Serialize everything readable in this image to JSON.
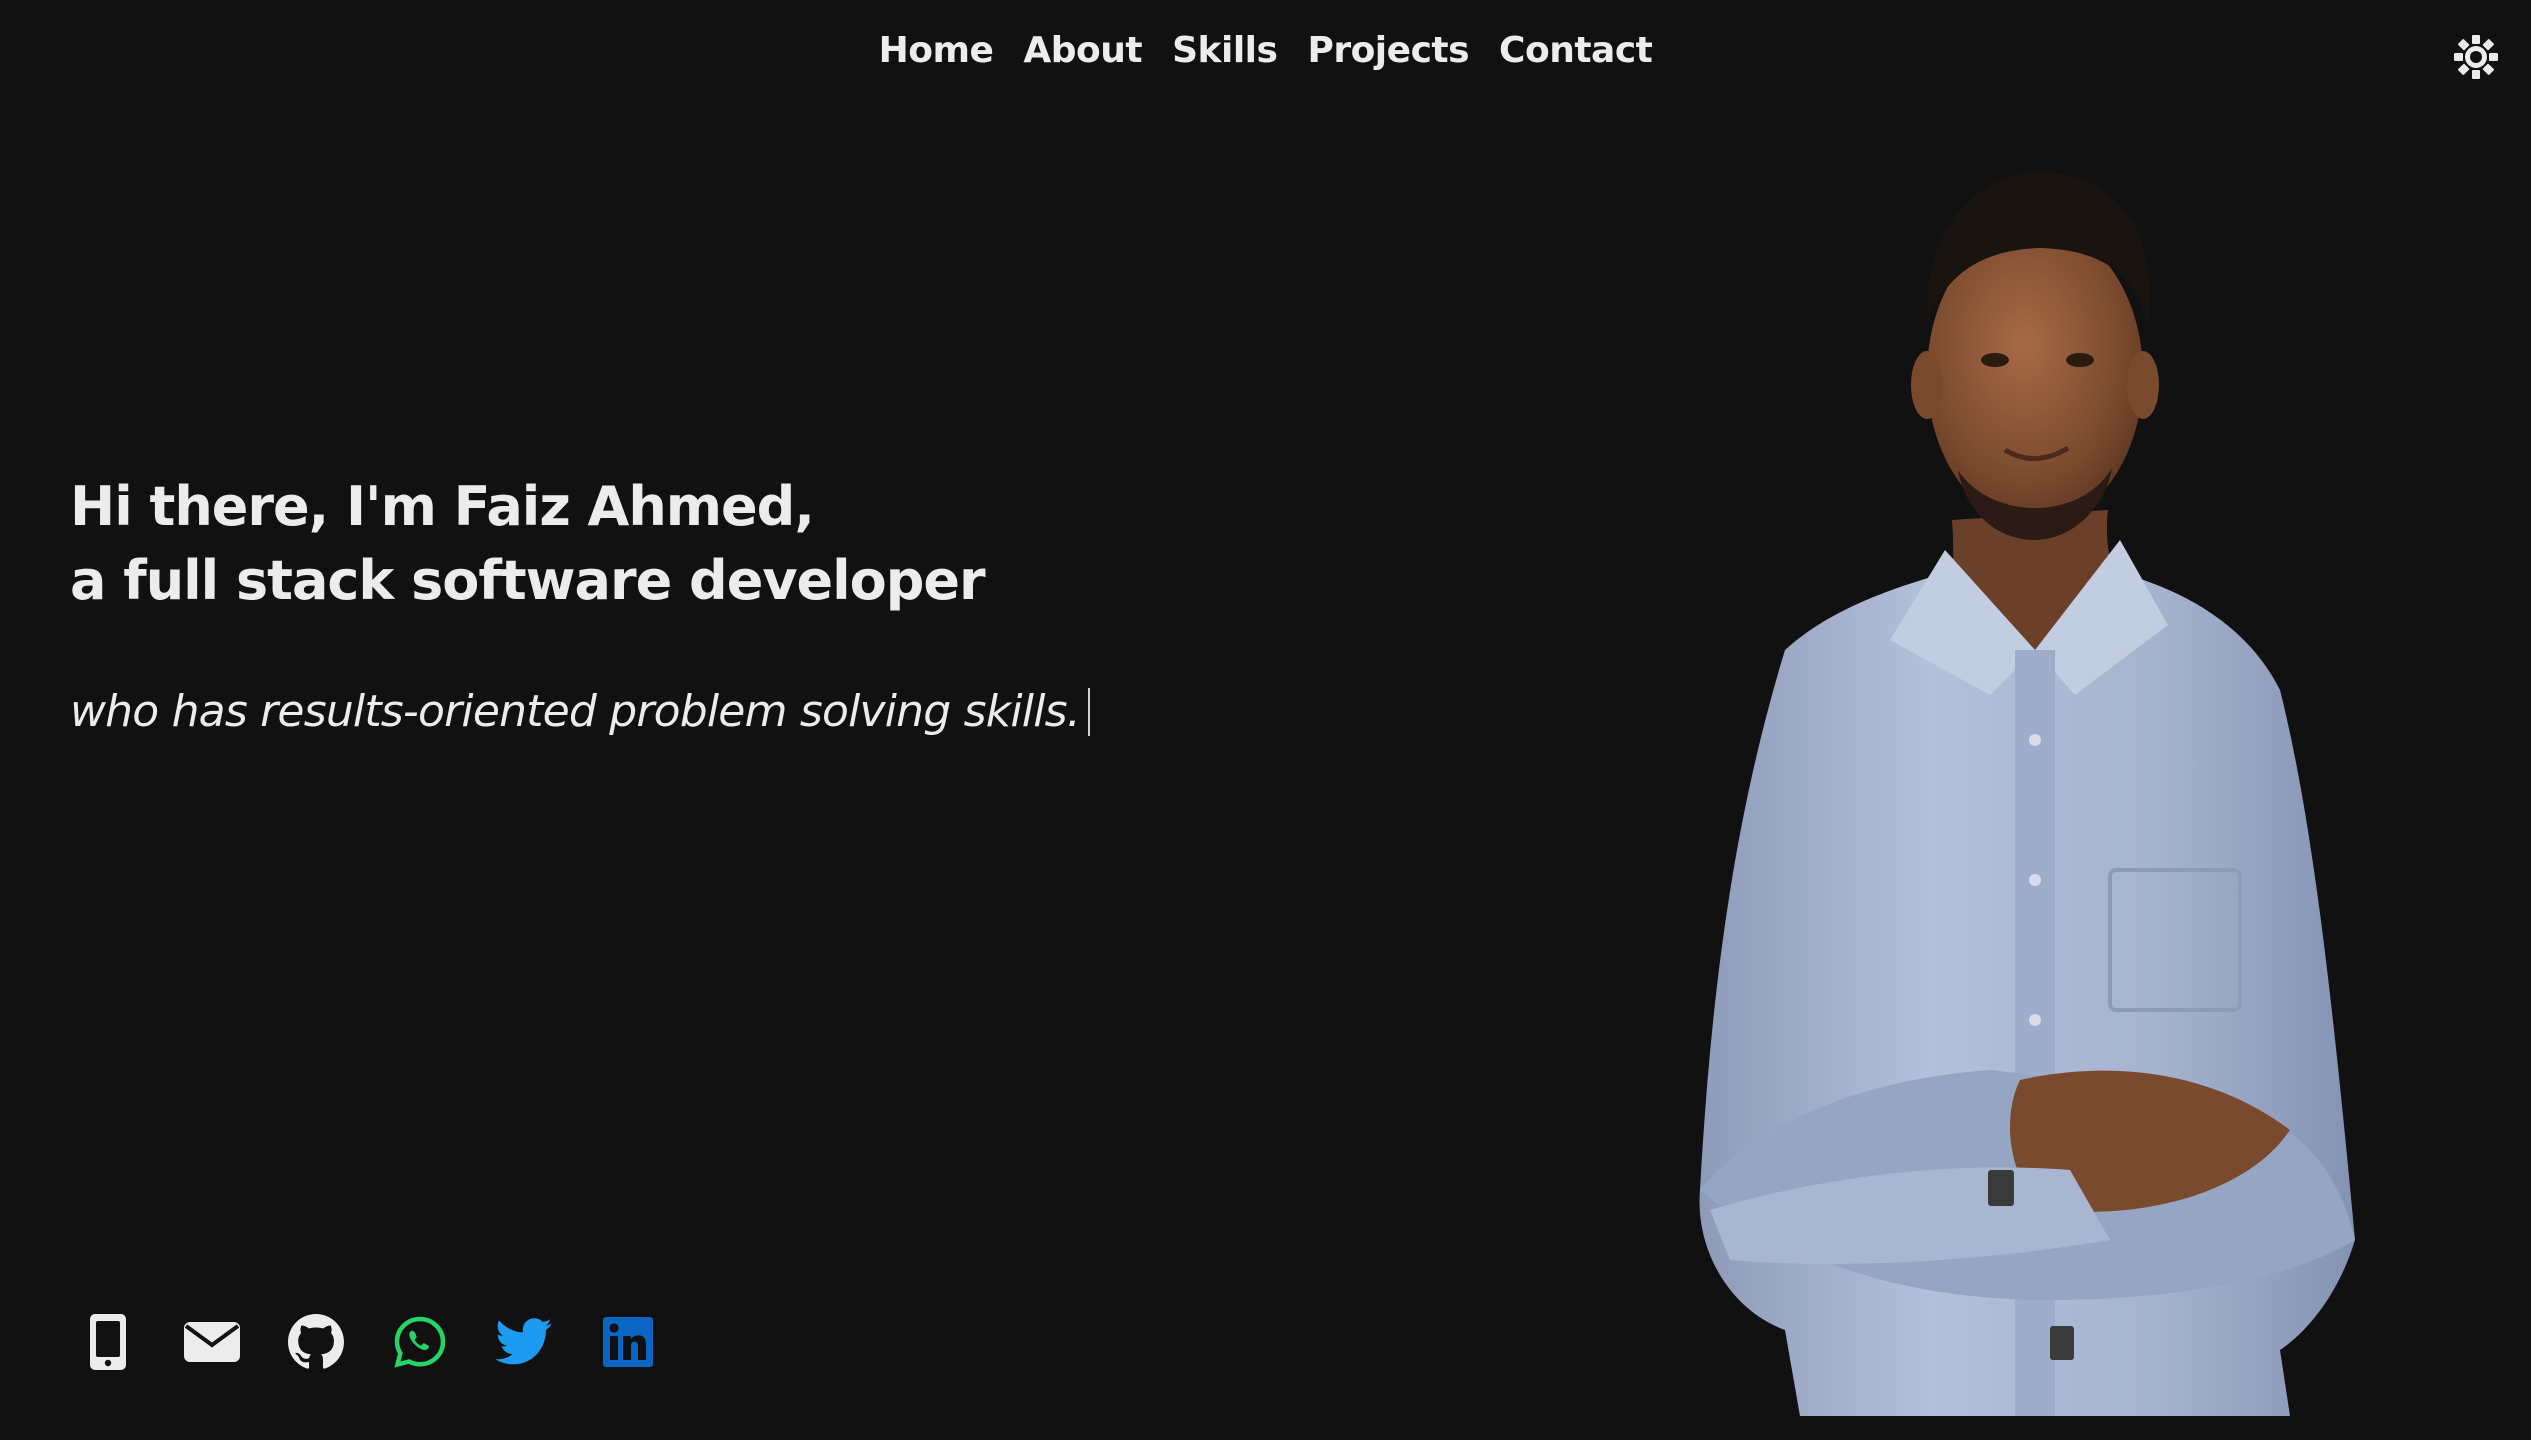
{
  "nav": {
    "items": [
      {
        "label": "Home"
      },
      {
        "label": "About"
      },
      {
        "label": "Skills"
      },
      {
        "label": "Projects"
      },
      {
        "label": "Contact"
      }
    ]
  },
  "theme_toggle": {
    "icon": "sun-icon"
  },
  "hero": {
    "headline_line1": "Hi there, I'm Faiz Ahmed,",
    "headline_line2": "a full stack software developer",
    "tagline": "who has results-oriented problem solving skills."
  },
  "social": [
    {
      "icon": "phone-icon",
      "color": "#ececec"
    },
    {
      "icon": "envelope-icon",
      "color": "#ececec"
    },
    {
      "icon": "github-icon",
      "color": "#ececec"
    },
    {
      "icon": "whatsapp-icon",
      "color": "#25d366"
    },
    {
      "icon": "twitter-icon",
      "color": "#1d9bf0"
    },
    {
      "icon": "linkedin-icon",
      "color": "#0a66c2"
    }
  ],
  "colors": {
    "background": "#111111",
    "text": "#ececec",
    "shirt": "#a9b6d1"
  }
}
